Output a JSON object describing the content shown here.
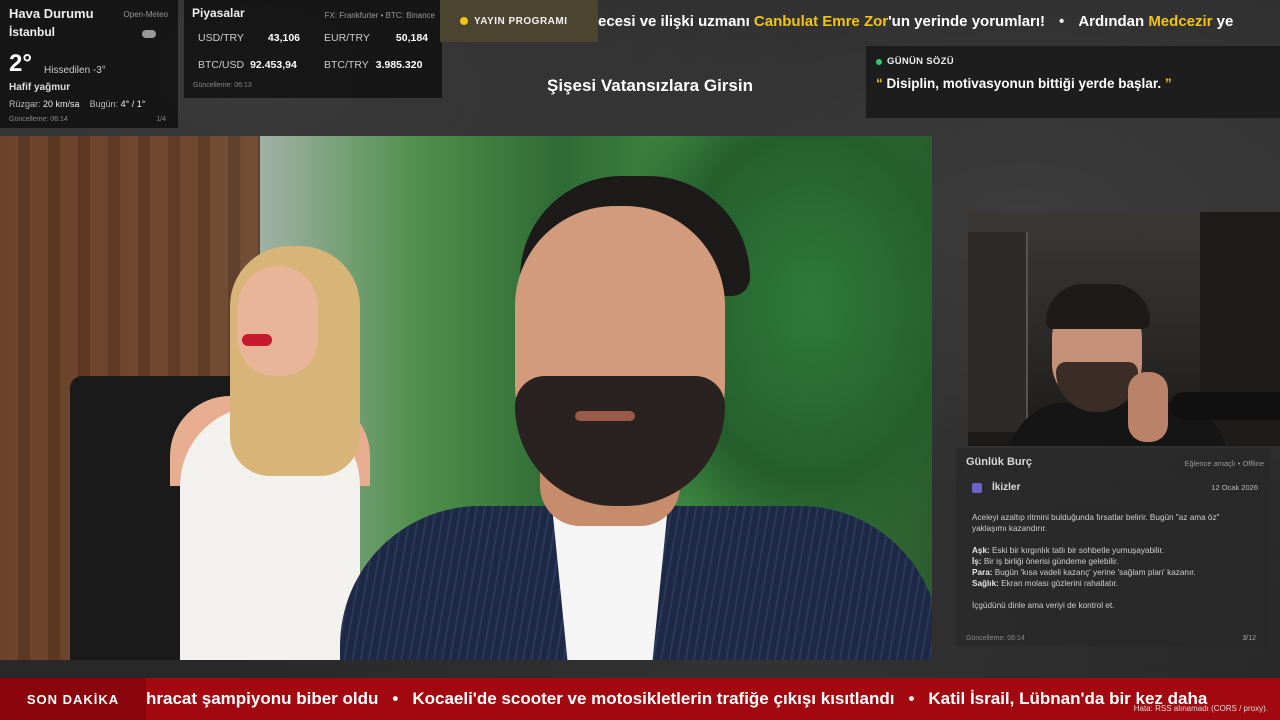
{
  "weather": {
    "title": "Hava Durumu",
    "source": "Open-Meteo",
    "city": "İstanbul",
    "temp": "2°",
    "feels_like": "Hissedilen -3°",
    "condition": "Hafif yağmur",
    "wind_label": "Rüzgar:",
    "wind_value": "20 km/sa",
    "today_label": "Bugün:",
    "today_value": "4° / 1°",
    "updated": "Güncelleme: 06:14",
    "page": "1/4"
  },
  "markets": {
    "title": "Piyasalar",
    "source": "FX: Frankfurter • BTC: Binance",
    "rows": [
      {
        "k": "USD/TRY",
        "v": "43,106"
      },
      {
        "k": "EUR/TRY",
        "v": "50,184"
      },
      {
        "k": "BTC/USD",
        "v": "92.453,94"
      },
      {
        "k": "BTC/TRY",
        "v": "3.985.320"
      }
    ],
    "updated": "Güncelleme: 06:13"
  },
  "schedule_button": "YAYIN PROGRAMI",
  "top_ticker": {
    "parts": [
      {
        "t": "ecesi ve ilişki uzmanı ",
        "hl": false
      },
      {
        "t": "Canbulat Emre Zor",
        "hl": true
      },
      {
        "t": "'un yerinde yorumları!",
        "hl": false
      },
      {
        "t": "•",
        "hl": false,
        "sep": true
      },
      {
        "t": "Ardından ",
        "hl": false
      },
      {
        "t": "Medcezir",
        "hl": true
      },
      {
        "t": " ye",
        "hl": false
      }
    ]
  },
  "program_title": "Şişesi Vatansızlara Girsin",
  "quote": {
    "label": "GÜNÜN SÖZÜ",
    "open": "“",
    "text": "Disiplin, motivasyonun bittiği yerde başlar.",
    "close": "”"
  },
  "horoscope": {
    "title": "Günlük Burç",
    "note": "Eğlence amaçlı • Offline",
    "sign": "İkizler",
    "date": "12 Ocak 2026",
    "intro": "Aceleyi azaltıp ritmini bulduğunda fırsatlar belirir. Bugün \"az ama öz\" yaklaşımı kazandırır.",
    "lines": [
      {
        "k": "Aşk:",
        "v": "Eski bir kırgınlık tatlı bir sohbetle yumuşayabilir."
      },
      {
        "k": "İş:",
        "v": "Bir iş birliği önerisi gündeme gelebilir."
      },
      {
        "k": "Para:",
        "v": "Bugün 'kısa vadeli kazanç' yerine 'sağlam plan' kazanır."
      },
      {
        "k": "Sağlık:",
        "v": "Ekran molası gözlerini rahatlatır."
      }
    ],
    "outro": "İçgüdünü dinle ama veriyi de kontrol et.",
    "updated": "Güncelleme: 06:14",
    "page": "3/12"
  },
  "breaking": {
    "label": "SON DAKİKA",
    "items": [
      "hracat şampiyonu biber oldu",
      "Kocaeli'de scooter ve motosikletlerin trafiğe çıkışı kısıtlandı",
      "Katil İsrail, Lübnan'da bir kez daha"
    ],
    "error": "Hata: RSS alınamadı (CORS / proxy)."
  },
  "colors": {
    "accent_yellow": "#f1c40f",
    "breaking_red": "#a2080f",
    "status_green": "#2ecc71"
  }
}
